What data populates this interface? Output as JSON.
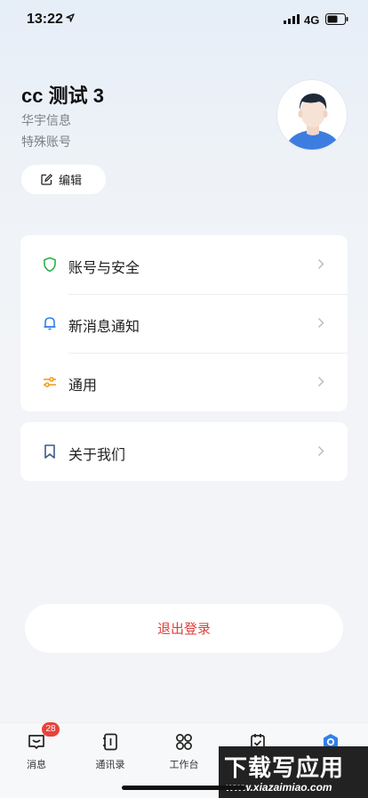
{
  "status_bar": {
    "time": "13:22",
    "network": "4G"
  },
  "profile": {
    "name": "cc 测试 3",
    "organization": "华宇信息",
    "role": "特殊账号",
    "edit_label": "编辑"
  },
  "menu": {
    "items": [
      {
        "label": "账号与安全",
        "icon": "shield-icon",
        "color": "#2bb14a"
      },
      {
        "label": "新消息通知",
        "icon": "bell-icon",
        "color": "#2f80ed"
      },
      {
        "label": "通用",
        "icon": "sliders-icon",
        "color": "#f0a020"
      }
    ],
    "about": {
      "label": "关于我们",
      "icon": "bookmark-icon",
      "color": "#3c5a8a"
    }
  },
  "logout_label": "退出登录",
  "tab_bar": {
    "tabs": [
      {
        "label": "消息",
        "badge": "28"
      },
      {
        "label": "通讯录"
      },
      {
        "label": "工作台"
      }
    ],
    "active_color": "#2f80ed"
  },
  "watermark": {
    "title": "下载写应用",
    "url": "www.xiazaimiao.com"
  }
}
